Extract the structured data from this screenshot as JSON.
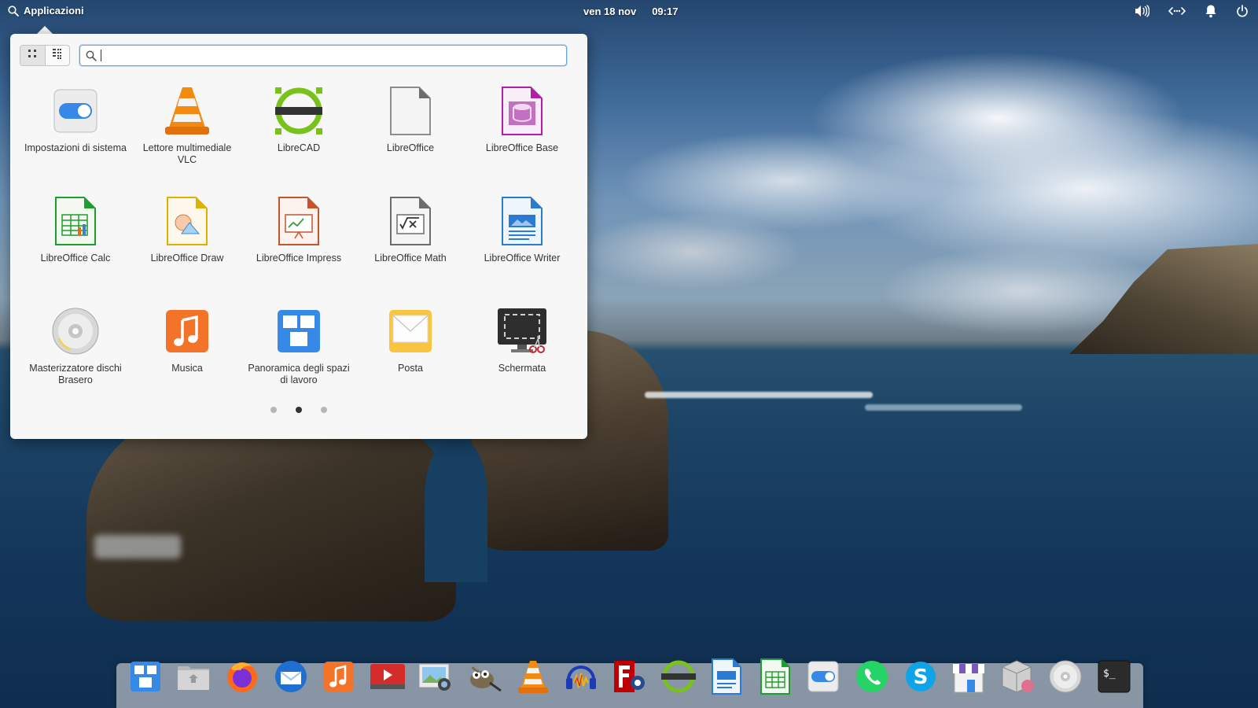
{
  "topbar": {
    "apps_label": "Applicazioni",
    "date": "ven 18 nov",
    "time": "09:17",
    "tray_icons": [
      "volume-icon",
      "network-icon",
      "notifications-icon",
      "power-icon"
    ]
  },
  "launcher": {
    "search_value": "",
    "view_modes": [
      "grid-view-icon",
      "category-view-icon"
    ],
    "apps": [
      {
        "label": "Impostazioni di sistema",
        "icon": "system-settings-icon"
      },
      {
        "label": "Lettore multimediale VLC",
        "icon": "vlc-icon"
      },
      {
        "label": "LibreCAD",
        "icon": "librecad-icon"
      },
      {
        "label": "LibreOffice",
        "icon": "libreoffice-icon"
      },
      {
        "label": "LibreOffice Base",
        "icon": "libreoffice-base-icon"
      },
      {
        "label": "LibreOffice Calc",
        "icon": "libreoffice-calc-icon"
      },
      {
        "label": "LibreOffice Draw",
        "icon": "libreoffice-draw-icon"
      },
      {
        "label": "LibreOffice Impress",
        "icon": "libreoffice-impress-icon"
      },
      {
        "label": "LibreOffice Math",
        "icon": "libreoffice-math-icon"
      },
      {
        "label": "LibreOffice Writer",
        "icon": "libreoffice-writer-icon"
      },
      {
        "label": "Masterizzatore dischi Brasero",
        "icon": "brasero-icon"
      },
      {
        "label": "Musica",
        "icon": "music-icon"
      },
      {
        "label": "Panoramica degli spazi di lavoro",
        "icon": "multitasking-view-icon"
      },
      {
        "label": "Posta",
        "icon": "mail-icon"
      },
      {
        "label": "Schermata",
        "icon": "screenshot-icon"
      }
    ],
    "pages": 3,
    "current_page": 2
  },
  "dock": {
    "items": [
      "multitasking-view-icon",
      "files-icon",
      "firefox-icon",
      "thunderbird-icon",
      "music-icon",
      "videos-icon",
      "photos-icon",
      "gimp-icon",
      "vlc-icon",
      "audacity-icon",
      "filezilla-icon",
      "librecad-icon",
      "libreoffice-writer-icon",
      "libreoffice-calc-icon",
      "system-settings-icon",
      "whatsapp-icon",
      "skype-icon",
      "appcenter-icon",
      "package-installer-icon",
      "brasero-icon",
      "terminal-icon"
    ]
  },
  "colors": {
    "accent": "#3689e6",
    "popover_bg": "#f7f7f7",
    "label_text": "#333333"
  }
}
